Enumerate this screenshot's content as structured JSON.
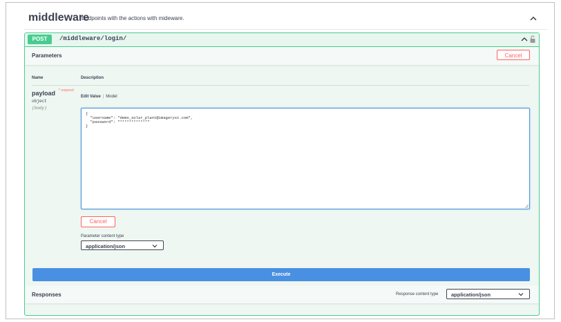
{
  "tag": {
    "name": "middleware",
    "description": "Endpoints with the actions with mideware."
  },
  "operation": {
    "method": "POST",
    "path": "/middleware/login/"
  },
  "parameters": {
    "section_title": "Parameters",
    "cancel_label": "Cancel",
    "col_name": "Name",
    "col_description": "Description",
    "param": {
      "name": "payload",
      "required_mark": "* required",
      "type": "object",
      "location": "(body)"
    },
    "tabs": {
      "edit_value": "Edit Value",
      "separator": "|",
      "model": "Model"
    },
    "body_text": "{\n  \"username\": \"demo_solar_plant@imageryst.com\",\n  \"password\": \"************\"\n}",
    "cancel_bottom_label": "Cancel",
    "content_type_label": "Parameter content type",
    "content_type_value": "application/json"
  },
  "execute_label": "Execute",
  "responses": {
    "title": "Responses",
    "content_type_label": "Response content type",
    "content_type_value": "application/json"
  },
  "colors": {
    "post": "#49cc90",
    "execute": "#4990e2",
    "cancel": "#ff6060"
  },
  "icons": [
    "chevron-up-icon",
    "lock-icon",
    "chevron-down-icon",
    "resize-handle-icon"
  ]
}
